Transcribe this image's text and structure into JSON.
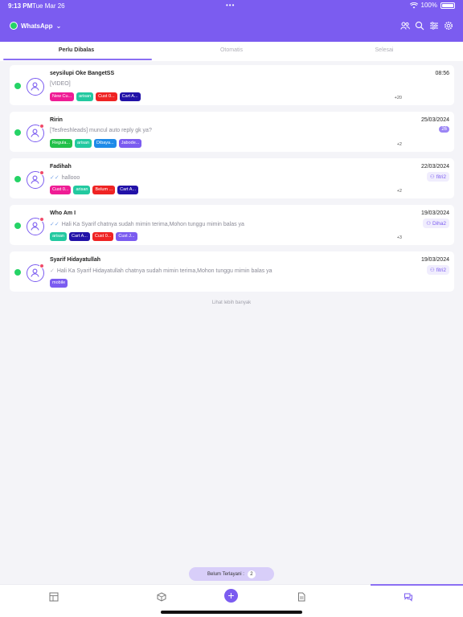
{
  "statusbar": {
    "time": "9:13 PM",
    "date": "Tue Mar 26",
    "dots": "•••",
    "battery": "100%"
  },
  "header": {
    "app_name": "WhatsApp"
  },
  "tabs": [
    {
      "label": "Perlu Dibalas"
    },
    {
      "label": "Otomatis"
    },
    {
      "label": "Selesai"
    }
  ],
  "chats": [
    {
      "name": "seysilupi Oke BangetSS",
      "preview": "[VIDEO]",
      "time": "08:56",
      "tags": [
        {
          "label": "New Cu...",
          "color": "#ef1c95"
        },
        {
          "label": "arisan",
          "color": "#22c9a0"
        },
        {
          "label": "Cust 0...",
          "color": "#ef2323"
        },
        {
          "label": "Cart A...",
          "color": "#2212a8"
        }
      ],
      "more": "+20"
    },
    {
      "name": "Ririn",
      "preview": "[Tesfreshleads] muncul auto reply gk ya?",
      "time": "25/03/2024",
      "unread": "26",
      "tags": [
        {
          "label": "Regula...",
          "color": "#22c04a"
        },
        {
          "label": "arisan",
          "color": "#22c9a0"
        },
        {
          "label": "Dibaya...",
          "color": "#1e8ae8"
        },
        {
          "label": "Jabode...",
          "color": "#7b5cf0"
        }
      ],
      "more": "+2"
    },
    {
      "name": "Fadihah",
      "preview": "hallooo",
      "time": "22/03/2024",
      "agent": "fitri2",
      "tags": [
        {
          "label": "Cust 0...",
          "color": "#ef1c95"
        },
        {
          "label": "arisan",
          "color": "#22c9a0"
        },
        {
          "label": "Belum ...",
          "color": "#ef2323"
        },
        {
          "label": "Cart A...",
          "color": "#2212a8"
        }
      ],
      "more": "+2"
    },
    {
      "name": "Who Am I",
      "preview": "Hali Ka Syarif chatnya sudah mimin terima,Mohon tunggu mimin balas ya",
      "time": "19/03/2024",
      "agent": "Diha2",
      "tags": [
        {
          "label": "arisan",
          "color": "#22c9a0"
        },
        {
          "label": "Cart A...",
          "color": "#2212a8"
        },
        {
          "label": "Cust 0...",
          "color": "#ef2323"
        },
        {
          "label": "Cust J...",
          "color": "#7b5cf0"
        }
      ],
      "more": "+3"
    },
    {
      "name": "Syarif Hidayatullah",
      "preview": "Hali Ka Syarif Hidayatullah chatnya sudah mimin terima,Mohon tunggu mimin balas ya",
      "time": "19/03/2024",
      "agent": "fitri2",
      "tags": [
        {
          "label": "mobile",
          "color": "#7b5cf0"
        }
      ],
      "more": ""
    }
  ],
  "load_more": "Lihat lebih banyak",
  "pending": {
    "label": "Belum Terlayani :",
    "count": "2"
  },
  "colors": {
    "primary": "#7b5cf0",
    "whatsapp": "#25d366"
  },
  "icons": [
    "users-icon",
    "search-icon",
    "filter-icon",
    "gear-icon",
    "dashboard-icon",
    "box-icon",
    "plus-icon",
    "document-icon",
    "chat-icon"
  ]
}
